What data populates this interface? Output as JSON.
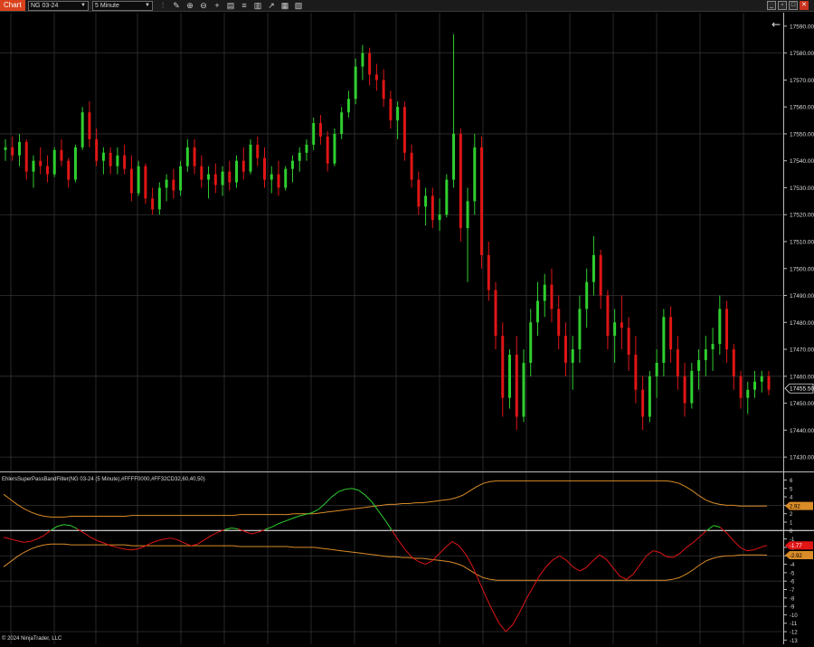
{
  "toolbar": {
    "chart_tab": "Chart",
    "instrument": "NG 03-24",
    "interval": "5 Minute",
    "icons": [
      "bar-type-icon",
      "draw-icon",
      "zoom-in-icon",
      "zoom-out-icon",
      "crosshair-icon",
      "properties-icon",
      "strategies-icon",
      "templates-icon",
      "indicators-icon",
      "data-box-icon",
      "chart-trader-icon"
    ],
    "window_buttons": [
      "minimize",
      "restore",
      "maximize",
      "close"
    ]
  },
  "colors": {
    "up": "#2fcf2f",
    "down": "#e01515",
    "band": "#d98c28",
    "grid": "#333333",
    "background": "#000000"
  },
  "price_axis": {
    "ticks": [
      "17590.00",
      "17580.00",
      "17570.00",
      "17560.00",
      "17550.00",
      "17540.00",
      "17530.00",
      "17520.00",
      "17510.00",
      "17500.00",
      "17490.00",
      "17480.00",
      "17470.00",
      "17460.00",
      "17450.00",
      "17440.00",
      "17430.00"
    ],
    "last_price": "17455.50"
  },
  "indicator": {
    "label": "EhlersSuperPassBandFilter(NG 03-24 (5 Minute),#FFFF0000,#FF32CD32,60,40,50)",
    "ticks": [
      "6",
      "5",
      "4",
      "3",
      "2",
      "1",
      "0",
      "-1",
      "-2",
      "-3",
      "-4",
      "-5",
      "-6",
      "-7",
      "-8",
      "-9",
      "-10",
      "-11",
      "-12",
      "-13"
    ],
    "upper_band_value": "2.92",
    "current_value": "-1.77",
    "lower_band_value": "-2.92"
  },
  "chart_data": {
    "type": "candlestick",
    "price_range": [
      17425,
      17595
    ],
    "candles": [
      [
        17544,
        17548,
        17540,
        17545
      ],
      [
        17545,
        17549,
        17540,
        17542
      ],
      [
        17542,
        17550,
        17538,
        17547
      ],
      [
        17547,
        17548,
        17533,
        17536
      ],
      [
        17536,
        17542,
        17530,
        17540
      ],
      [
        17540,
        17545,
        17535,
        17538
      ],
      [
        17538,
        17542,
        17532,
        17535
      ],
      [
        17535,
        17545,
        17534,
        17544
      ],
      [
        17544,
        17548,
        17538,
        17540
      ],
      [
        17540,
        17541,
        17530,
        17533
      ],
      [
        17533,
        17546,
        17532,
        17545
      ],
      [
        17545,
        17560,
        17544,
        17558
      ],
      [
        17558,
        17562,
        17545,
        17548
      ],
      [
        17548,
        17552,
        17538,
        17540
      ],
      [
        17540,
        17545,
        17535,
        17543
      ],
      [
        17543,
        17545,
        17535,
        17538
      ],
      [
        17538,
        17545,
        17535,
        17542
      ],
      [
        17542,
        17546,
        17535,
        17537
      ],
      [
        17537,
        17542,
        17525,
        17528
      ],
      [
        17528,
        17540,
        17527,
        17538
      ],
      [
        17538,
        17539,
        17524,
        17526
      ],
      [
        17526,
        17530,
        17520,
        17522
      ],
      [
        17522,
        17532,
        17520,
        17530
      ],
      [
        17530,
        17535,
        17525,
        17533
      ],
      [
        17533,
        17537,
        17526,
        17529
      ],
      [
        17529,
        17540,
        17527,
        17538
      ],
      [
        17538,
        17548,
        17536,
        17545
      ],
      [
        17545,
        17548,
        17535,
        17538
      ],
      [
        17538,
        17542,
        17530,
        17533
      ],
      [
        17533,
        17538,
        17526,
        17535
      ],
      [
        17535,
        17539,
        17528,
        17531
      ],
      [
        17531,
        17538,
        17527,
        17536
      ],
      [
        17536,
        17540,
        17529,
        17532
      ],
      [
        17532,
        17542,
        17530,
        17540
      ],
      [
        17540,
        17545,
        17533,
        17536
      ],
      [
        17536,
        17548,
        17535,
        17546
      ],
      [
        17546,
        17549,
        17538,
        17541
      ],
      [
        17541,
        17545,
        17530,
        17533
      ],
      [
        17533,
        17538,
        17528,
        17535
      ],
      [
        17535,
        17540,
        17527,
        17530
      ],
      [
        17530,
        17538,
        17529,
        17537
      ],
      [
        17537,
        17542,
        17532,
        17540
      ],
      [
        17540,
        17545,
        17536,
        17543
      ],
      [
        17543,
        17548,
        17540,
        17546
      ],
      [
        17546,
        17556,
        17544,
        17554
      ],
      [
        17554,
        17557,
        17546,
        17549
      ],
      [
        17549,
        17551,
        17536,
        17539
      ],
      [
        17539,
        17552,
        17538,
        17550
      ],
      [
        17550,
        17560,
        17548,
        17558
      ],
      [
        17558,
        17566,
        17556,
        17563
      ],
      [
        17563,
        17578,
        17561,
        17575
      ],
      [
        17575,
        17583,
        17570,
        17580
      ],
      [
        17580,
        17582,
        17568,
        17572
      ],
      [
        17572,
        17576,
        17566,
        17570
      ],
      [
        17570,
        17574,
        17560,
        17563
      ],
      [
        17563,
        17566,
        17552,
        17555
      ],
      [
        17555,
        17562,
        17548,
        17560
      ],
      [
        17560,
        17562,
        17540,
        17543
      ],
      [
        17543,
        17546,
        17530,
        17533
      ],
      [
        17533,
        17536,
        17520,
        17523
      ],
      [
        17523,
        17530,
        17516,
        17527
      ],
      [
        17527,
        17530,
        17515,
        17518
      ],
      [
        17518,
        17526,
        17514,
        17520
      ],
      [
        17520,
        17535,
        17519,
        17533
      ],
      [
        17533,
        17587,
        17530,
        17550
      ],
      [
        17550,
        17552,
        17510,
        17515
      ],
      [
        17515,
        17530,
        17495,
        17525
      ],
      [
        17525,
        17550,
        17520,
        17545
      ],
      [
        17545,
        17549,
        17500,
        17505
      ],
      [
        17505,
        17510,
        17488,
        17492
      ],
      [
        17492,
        17495,
        17470,
        17475
      ],
      [
        17475,
        17480,
        17445,
        17452
      ],
      [
        17452,
        17470,
        17448,
        17468
      ],
      [
        17468,
        17475,
        17440,
        17445
      ],
      [
        17445,
        17470,
        17443,
        17465
      ],
      [
        17465,
        17485,
        17460,
        17480
      ],
      [
        17480,
        17495,
        17475,
        17488
      ],
      [
        17488,
        17498,
        17482,
        17494
      ],
      [
        17494,
        17500,
        17480,
        17485
      ],
      [
        17485,
        17490,
        17470,
        17475
      ],
      [
        17475,
        17480,
        17460,
        17465
      ],
      [
        17465,
        17475,
        17455,
        17470
      ],
      [
        17470,
        17490,
        17465,
        17485
      ],
      [
        17485,
        17500,
        17478,
        17495
      ],
      [
        17495,
        17512,
        17490,
        17505
      ],
      [
        17505,
        17507,
        17485,
        17490
      ],
      [
        17490,
        17492,
        17470,
        17475
      ],
      [
        17475,
        17485,
        17465,
        17480
      ],
      [
        17480,
        17490,
        17470,
        17478
      ],
      [
        17478,
        17482,
        17462,
        17468
      ],
      [
        17468,
        17475,
        17450,
        17455
      ],
      [
        17455,
        17460,
        17440,
        17445
      ],
      [
        17445,
        17462,
        17443,
        17460
      ],
      [
        17460,
        17470,
        17452,
        17465
      ],
      [
        17465,
        17485,
        17460,
        17482
      ],
      [
        17482,
        17486,
        17465,
        17470
      ],
      [
        17470,
        17475,
        17455,
        17460
      ],
      [
        17460,
        17465,
        17445,
        17450
      ],
      [
        17450,
        17465,
        17448,
        17462
      ],
      [
        17462,
        17470,
        17455,
        17466
      ],
      [
        17466,
        17475,
        17460,
        17470
      ],
      [
        17470,
        17478,
        17462,
        17472
      ],
      [
        17472,
        17490,
        17468,
        17485
      ],
      [
        17485,
        17488,
        17465,
        17470
      ],
      [
        17470,
        17472,
        17455,
        17460
      ],
      [
        17460,
        17462,
        17448,
        17452
      ],
      [
        17452,
        17458,
        17446,
        17455
      ],
      [
        17455,
        17462,
        17452,
        17458
      ],
      [
        17458,
        17462,
        17454,
        17460
      ],
      [
        17460,
        17462,
        17453,
        17455
      ]
    ],
    "indicator_range": [
      -13.5,
      6.8
    ],
    "filter_series": [
      -0.8,
      -1.0,
      -1.2,
      -1.4,
      -1.3,
      -1.0,
      -0.6,
      0,
      0.5,
      0.7,
      0.6,
      0.2,
      -0.3,
      -0.8,
      -1.2,
      -1.5,
      -1.8,
      -2.0,
      -2.2,
      -2.3,
      -2.2,
      -1.9,
      -1.5,
      -1.2,
      -1.0,
      -0.9,
      -1.1,
      -1.5,
      -1.8,
      -1.6,
      -1.1,
      -0.6,
      -0.2,
      0.1,
      0.3,
      0.2,
      -0.1,
      -0.4,
      -0.2,
      0.1,
      0.4,
      0.8,
      1.1,
      1.4,
      1.7,
      1.9,
      2.1,
      2.5,
      3.2,
      4.0,
      4.6,
      4.9,
      5.0,
      4.8,
      4.2,
      3.4,
      2.3,
      1.2,
      0,
      -1.2,
      -2.3,
      -3.2,
      -3.7,
      -4.0,
      -3.6,
      -2.8,
      -2.0,
      -1.3,
      -1.8,
      -2.8,
      -4.2,
      -6.0,
      -7.8,
      -9.5,
      -11.0,
      -12.0,
      -11.2,
      -9.8,
      -8.2,
      -6.8,
      -5.4,
      -4.3,
      -3.5,
      -3.0,
      -3.5,
      -4.3,
      -4.8,
      -4.4,
      -3.6,
      -2.9,
      -3.4,
      -4.4,
      -5.4,
      -5.8,
      -5.2,
      -4.1,
      -3.0,
      -2.4,
      -2.6,
      -3.1,
      -3.2,
      -2.7,
      -2.0,
      -1.4,
      -0.7,
      0,
      0.6,
      0.4,
      -0.3,
      -1.2,
      -2.0,
      -2.4,
      -2.3,
      -2.0,
      -1.77
    ],
    "upper_band": [
      4.3,
      3.7,
      3.1,
      2.6,
      2.2,
      1.9,
      1.7,
      1.6,
      1.6,
      1.6,
      1.7,
      1.7,
      1.7,
      1.7,
      1.7,
      1.7,
      1.7,
      1.7,
      1.7,
      1.8,
      1.8,
      1.8,
      1.8,
      1.8,
      1.8,
      1.8,
      1.8,
      1.8,
      1.8,
      1.8,
      1.8,
      1.8,
      1.8,
      1.8,
      1.8,
      1.9,
      1.9,
      1.9,
      1.9,
      1.9,
      1.9,
      1.9,
      1.9,
      2.0,
      2.0,
      2.0,
      2.0,
      2.1,
      2.2,
      2.3,
      2.4,
      2.5,
      2.6,
      2.7,
      2.8,
      2.9,
      3.0,
      3.1,
      3.1,
      3.2,
      3.2,
      3.3,
      3.3,
      3.4,
      3.5,
      3.6,
      3.7,
      3.9,
      4.2,
      4.7,
      5.2,
      5.6,
      5.8,
      5.9,
      5.9,
      5.9,
      5.9,
      5.9,
      5.9,
      5.9,
      5.9,
      5.9,
      5.9,
      5.9,
      5.9,
      5.9,
      5.9,
      5.9,
      5.9,
      5.9,
      5.9,
      5.9,
      5.9,
      5.9,
      5.9,
      5.9,
      5.9,
      5.9,
      5.9,
      5.8,
      5.6,
      5.2,
      4.7,
      4.1,
      3.6,
      3.3,
      3.1,
      3.0,
      3.0,
      2.9,
      2.9,
      2.9,
      2.9,
      2.92
    ],
    "lower_band": [
      -4.3,
      -3.7,
      -3.1,
      -2.6,
      -2.2,
      -1.9,
      -1.7,
      -1.6,
      -1.6,
      -1.6,
      -1.7,
      -1.7,
      -1.7,
      -1.7,
      -1.7,
      -1.7,
      -1.7,
      -1.7,
      -1.7,
      -1.8,
      -1.8,
      -1.8,
      -1.8,
      -1.8,
      -1.8,
      -1.8,
      -1.8,
      -1.8,
      -1.8,
      -1.8,
      -1.8,
      -1.8,
      -1.8,
      -1.8,
      -1.8,
      -1.9,
      -1.9,
      -1.9,
      -1.9,
      -1.9,
      -1.9,
      -1.9,
      -1.9,
      -2.0,
      -2.0,
      -2.0,
      -2.0,
      -2.1,
      -2.2,
      -2.3,
      -2.4,
      -2.5,
      -2.6,
      -2.7,
      -2.8,
      -2.9,
      -3.0,
      -3.1,
      -3.1,
      -3.2,
      -3.2,
      -3.3,
      -3.3,
      -3.4,
      -3.5,
      -3.6,
      -3.7,
      -3.9,
      -4.2,
      -4.7,
      -5.2,
      -5.6,
      -5.8,
      -5.9,
      -5.9,
      -5.9,
      -5.9,
      -5.9,
      -5.9,
      -5.9,
      -5.9,
      -5.9,
      -5.9,
      -5.9,
      -5.9,
      -5.9,
      -5.9,
      -5.9,
      -5.9,
      -5.9,
      -5.9,
      -5.9,
      -5.9,
      -5.9,
      -5.9,
      -5.9,
      -5.9,
      -5.9,
      -5.9,
      -5.8,
      -5.6,
      -5.2,
      -4.7,
      -4.1,
      -3.6,
      -3.3,
      -3.1,
      -3.0,
      -3.0,
      -2.9,
      -2.9,
      -2.9,
      -2.9,
      -2.92
    ]
  },
  "copyright": "© 2024 NinjaTrader, LLC"
}
